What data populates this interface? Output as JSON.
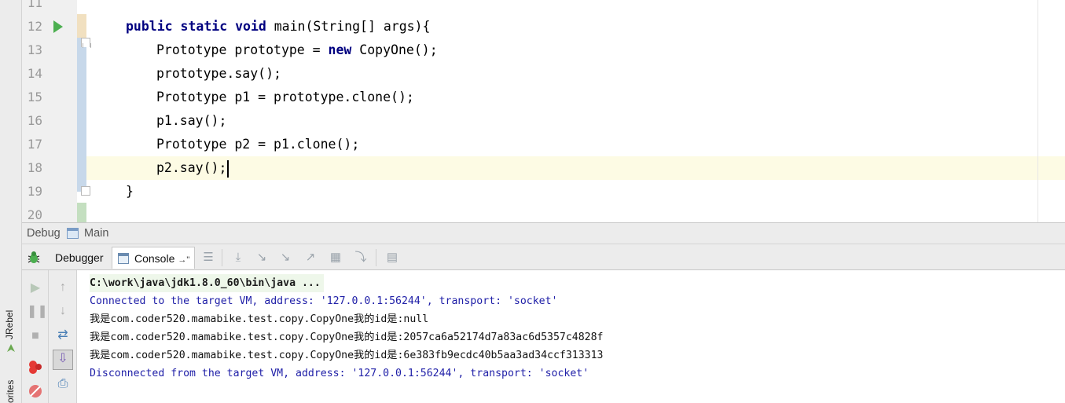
{
  "sidebar": {
    "jrebel_label": "JRebel",
    "favorites_label": "orites"
  },
  "editor": {
    "lines": [
      {
        "num": "11",
        "code": ""
      },
      {
        "num": "12",
        "code": "public static void main(String[] args){"
      },
      {
        "num": "13",
        "code": "Prototype prototype = new CopyOne();"
      },
      {
        "num": "14",
        "code": "prototype.say();"
      },
      {
        "num": "15",
        "code": "Prototype p1 = prototype.clone();"
      },
      {
        "num": "16",
        "code": "p1.say();"
      },
      {
        "num": "17",
        "code": "Prototype p2 = p1.clone();"
      },
      {
        "num": "18",
        "code": "p2.say();"
      },
      {
        "num": "19",
        "code": "}"
      },
      {
        "num": "20",
        "code": ""
      }
    ],
    "tokens": {
      "l12_a": "public static void",
      "l12_b": " main(String[] args){",
      "l13_a": "Prototype prototype = ",
      "l13_kw": "new",
      "l13_b": " CopyOne();"
    }
  },
  "debug_panel": {
    "title": "Debug",
    "config_name": "Main",
    "tabs": [
      {
        "label": "Debugger"
      },
      {
        "label": "Console",
        "suffix": "→\""
      }
    ]
  },
  "console": {
    "command": "C:\\work\\java\\jdk1.8.0_60\\bin\\java ...",
    "lines": [
      {
        "text": "Connected to the target VM, address: '127.0.0.1:56244', transport: 'socket'",
        "kind": "info"
      },
      {
        "text": "我是com.coder520.mamabike.test.copy.CopyOne我的id是:null",
        "kind": "std"
      },
      {
        "text": "我是com.coder520.mamabike.test.copy.CopyOne我的id是:2057ca6a52174d7a83ac6d5357c4828f",
        "kind": "std"
      },
      {
        "text": "我是com.coder520.mamabike.test.copy.CopyOne我的id是:6e383fb9ecdc40b5aa3ad34ccf313313",
        "kind": "std"
      },
      {
        "text": "Disconnected from the target VM, address: '127.0.0.1:56244', transport: 'socket'",
        "kind": "info"
      }
    ]
  },
  "colors": {
    "keyword": "#000080",
    "info_text": "#2020a8",
    "current_line": "#fdfbe4",
    "run_icon": "#4caf50"
  }
}
